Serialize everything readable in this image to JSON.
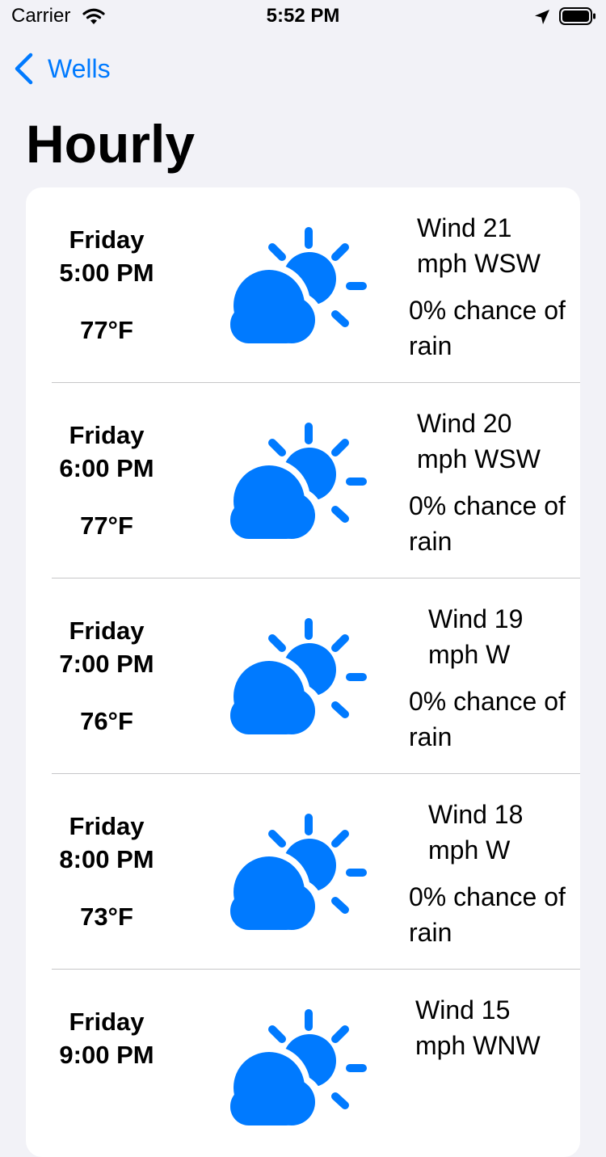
{
  "status_bar": {
    "carrier": "Carrier",
    "time": "5:52 PM"
  },
  "nav": {
    "back_label": "Wells"
  },
  "page": {
    "title": "Hourly"
  },
  "colors": {
    "accent": "#007aff",
    "background": "#f2f2f7",
    "card": "#ffffff"
  },
  "hours": [
    {
      "day": "Friday",
      "time": "5:00 PM",
      "temp": "77°F",
      "icon": "partly-cloudy-day-icon",
      "wind": "Wind 21 mph WSW",
      "rain": "0% chance of rain"
    },
    {
      "day": "Friday",
      "time": "6:00 PM",
      "temp": "77°F",
      "icon": "partly-cloudy-day-icon",
      "wind": "Wind 20 mph WSW",
      "rain": "0% chance of rain"
    },
    {
      "day": "Friday",
      "time": "7:00 PM",
      "temp": "76°F",
      "icon": "partly-cloudy-day-icon",
      "wind": "Wind 19 mph W",
      "rain": "0% chance of rain"
    },
    {
      "day": "Friday",
      "time": "8:00 PM",
      "temp": "73°F",
      "icon": "partly-cloudy-day-icon",
      "wind": "Wind 18 mph W",
      "rain": "0% chance of rain"
    },
    {
      "day": "Friday",
      "time": "9:00 PM",
      "temp": "",
      "icon": "partly-cloudy-day-icon",
      "wind": "Wind 15 mph WNW",
      "rain": ""
    }
  ]
}
